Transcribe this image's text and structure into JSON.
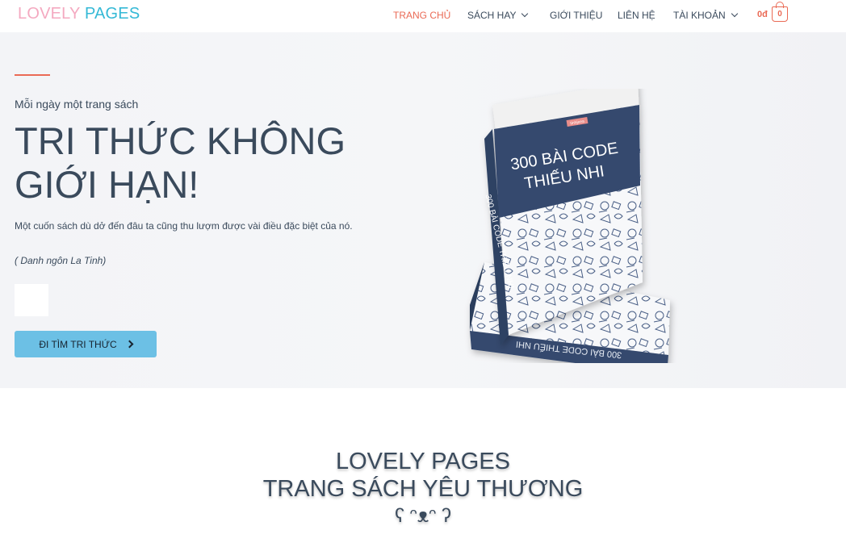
{
  "header": {
    "logo_word1": "LOVELY",
    "logo_word2": "PAGES",
    "nav": [
      {
        "label": "TRANG CHỦ",
        "active": true
      },
      {
        "label": "SÁCH HAY",
        "dropdown": true
      },
      {
        "label": "GIỚI THIỆU"
      },
      {
        "label": "LIÊN HỆ"
      },
      {
        "label": "TÀI KHOẢN",
        "dropdown": true
      }
    ],
    "cart_total": "0đ",
    "cart_count": "0"
  },
  "hero": {
    "tagline": "Mỗi ngày một trang sách",
    "headline": "TRI THỨC KHÔNG GIỚI HẠN!",
    "quote": "Một cuốn sách dù dở đến đâu ta cũng thu lượm được vài điều đặc biệt của nó.",
    "quote_source": "( Danh ngôn La Tinh)",
    "cta_label": "ĐI TÌM TRI THỨC",
    "book": {
      "publisher": "tinhjeea",
      "title_line1": "300 BÀI CODE",
      "title_line2": "THIẾU NHI",
      "spine": "300 BÀI CODE THIẾU NHI"
    }
  },
  "intro": {
    "line1": "LOVELY PAGES",
    "line2": "TRANG SÁCH YÊU THƯƠNG",
    "line3": "ʕ ᵔᴥᵔ ʔ"
  },
  "colors": {
    "accent": "#ea6a55",
    "logo_pink": "#f4a9c0",
    "logo_blue": "#35b9d6",
    "cta": "#6cc0e5",
    "text": "#3a4a5c",
    "book_navy": "#364a6e"
  }
}
